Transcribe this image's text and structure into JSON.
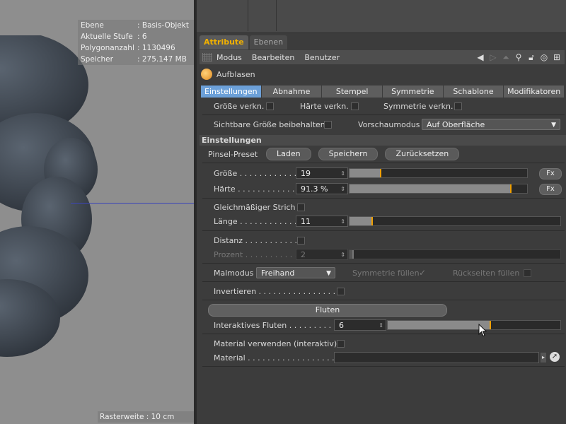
{
  "viewport": {
    "hud": [
      {
        "key": "Ebene",
        "value": ": Basis-Objekt"
      },
      {
        "key": "Aktuelle Stufe",
        "value": ": 6"
      },
      {
        "key": "Polygonanzahl",
        "value": ": 1130496"
      },
      {
        "key": "Speicher",
        "value": ": 275.147 MB"
      }
    ],
    "grid_label": "Rasterweite : 10 cm"
  },
  "tabs": [
    "Attribute",
    "Ebenen"
  ],
  "menu": [
    "Modus",
    "Bearbeiten",
    "Benutzer"
  ],
  "tool_title": "Aufblasen",
  "subtabs": [
    "Einstellungen",
    "Abnahme",
    "Stempel",
    "Symmetrie",
    "Schablone",
    "Modifikatoren"
  ],
  "link_row": {
    "groesse": "Größe verkn.",
    "haerte": "Härte verkn.",
    "symmetrie": "Symmetrie verkn."
  },
  "visible_size": "Sichtbare Größe beibehalten",
  "preview": {
    "label": "Vorschaumodus",
    "value": "Auf Oberfläche"
  },
  "section_title": "Einstellungen",
  "preset": {
    "label": "Pinsel-Preset",
    "buttons": [
      "Laden",
      "Speichern",
      "Zurücksetzen"
    ]
  },
  "groesse": {
    "label": "Größe . . . . . . . . . . . .",
    "value": "19",
    "fx": "Fx",
    "level": 0.18
  },
  "haerte": {
    "label": "Härte . . . . . . . . . . . . .",
    "value": "91.3 %",
    "fx": "Fx",
    "level": 0.913
  },
  "stroke": {
    "label": "Gleichmäßiger Strich"
  },
  "laenge": {
    "label": "Länge . . . . . . . . . . . .",
    "value": "11",
    "level": 0.11
  },
  "distanz": {
    "label": "Distanz . . . . . . . . . . ."
  },
  "prozent": {
    "label": "Prozent . . . . . . . . . . .",
    "value": "2",
    "level": 0.02
  },
  "malmodus": {
    "label": "Malmodus",
    "value": "Freihand"
  },
  "symfill": "Symmetrie füllen",
  "backfill": "Rückseiten füllen",
  "invert": "Invertieren . . . . . . . . . . . . . . . .",
  "fluten": "Fluten",
  "interactive": {
    "label": "Interaktives Fluten . . . . . . . . . . .",
    "value": "6",
    "level": 0.6
  },
  "material_use": "Material verwenden (interaktiv)",
  "material": "Material . . . . . . . . . . . . . . . . . . . . ."
}
